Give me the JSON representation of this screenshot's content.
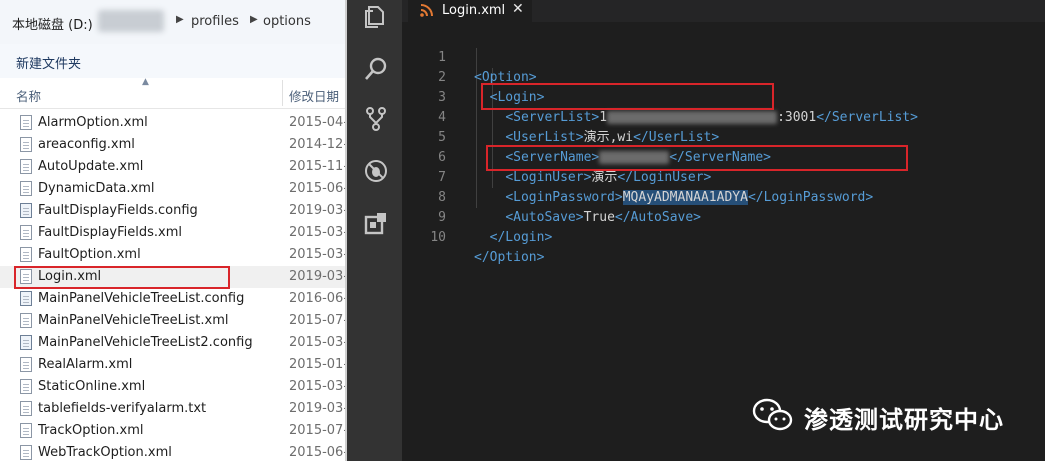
{
  "explorer": {
    "address": {
      "drive": "本地磁盘 (D:)",
      "crumbs": [
        "profiles",
        "options"
      ]
    },
    "toolbar": {
      "new_folder": "新建文件夹"
    },
    "columns": {
      "name": "名称",
      "date": "修改日期"
    },
    "files": [
      {
        "name": "AlarmOption.xml",
        "date": "2015-04-"
      },
      {
        "name": "areaconfig.xml",
        "date": "2014-12-"
      },
      {
        "name": "AutoUpdate.xml",
        "date": "2015-11-"
      },
      {
        "name": "DynamicData.xml",
        "date": "2015-06-"
      },
      {
        "name": "FaultDisplayFields.config",
        "date": "2019-03-"
      },
      {
        "name": "FaultDisplayFields.xml",
        "date": "2015-03-"
      },
      {
        "name": "FaultOption.xml",
        "date": "2015-03-"
      },
      {
        "name": "Login.xml",
        "date": "2019-03-"
      },
      {
        "name": "MainPanelVehicleTreeList.config",
        "date": "2016-06-"
      },
      {
        "name": "MainPanelVehicleTreeList.xml",
        "date": "2015-07-"
      },
      {
        "name": "MainPanelVehicleTreeList2.config",
        "date": "2015-03-"
      },
      {
        "name": "RealAlarm.xml",
        "date": "2015-01-"
      },
      {
        "name": "StaticOnline.xml",
        "date": "2015-03-"
      },
      {
        "name": "tablefields-verifyalarm.txt",
        "date": "2019-03-"
      },
      {
        "name": "TrackOption.xml",
        "date": "2015-07-"
      },
      {
        "name": "WebTrackOption.xml",
        "date": "2015-06-"
      }
    ]
  },
  "activity_bar": [
    "files-icon",
    "search-icon",
    "source-control-icon",
    "debug-icon",
    "extensions-icon"
  ],
  "editor": {
    "tab": {
      "title": "Login.xml",
      "close": "✕"
    },
    "line_numbers": [
      "1",
      "2",
      "3",
      "4",
      "5",
      "6",
      "7",
      "8",
      "9",
      "10"
    ],
    "code": {
      "option_open": "<Option>",
      "login_open": "<Login>",
      "serverlist_open": "<ServerList>",
      "serverlist_prefix": "1",
      "serverlist_port": ":3001",
      "serverlist_close": "</ServerList>",
      "userlist_open": "<UserList>",
      "userlist_value": "演示,wi",
      "userlist_close": "</UserList>",
      "servername_open": "<ServerName>",
      "servername_close": "</ServerName>",
      "loginuser_open": "<LoginUser>",
      "loginuser_value": "演示",
      "loginuser_close": "</LoginUser>",
      "loginpassword_open": "<LoginPassword>",
      "loginpassword_value": "MQAyADMANAA1ADYA",
      "loginpassword_close": "</LoginPassword>",
      "autosave_open": "<AutoSave>",
      "autosave_value": "True",
      "autosave_close": "</AutoSave>",
      "login_close": "</Login>",
      "option_close": "</Option>"
    }
  },
  "watermark": {
    "text": "渗透测试研究中心",
    "icon": "wechat-icon"
  },
  "colors": {
    "highlight_box": "#d9252a",
    "tag": "#569cd6",
    "text": "#d4d4d4",
    "selection": "#264f78"
  }
}
